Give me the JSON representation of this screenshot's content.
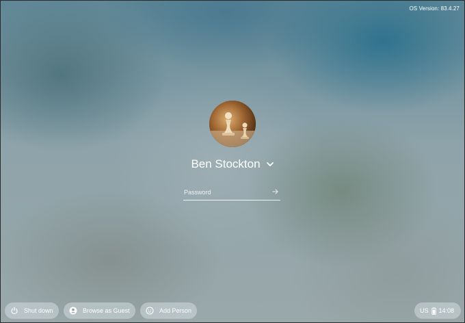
{
  "system": {
    "os_version": "OS Version: 83.4.27"
  },
  "login": {
    "user_name": "Ben Stockton",
    "avatar_icon": "chess-pawns-photo",
    "password_placeholder": "Password",
    "password_value": "",
    "submit_icon": "arrow-right-icon",
    "user_menu_icon": "chevron-down-icon"
  },
  "shelf": {
    "shutdown_label": "Shut down",
    "shutdown_icon": "power-icon",
    "guest_label": "Browse as Guest",
    "guest_icon": "account-circle-icon",
    "add_label": "Add Person",
    "add_icon": "add-person-icon"
  },
  "tray": {
    "keyboard_layout": "US",
    "battery_icon": "battery-icon",
    "time": "14:08"
  }
}
